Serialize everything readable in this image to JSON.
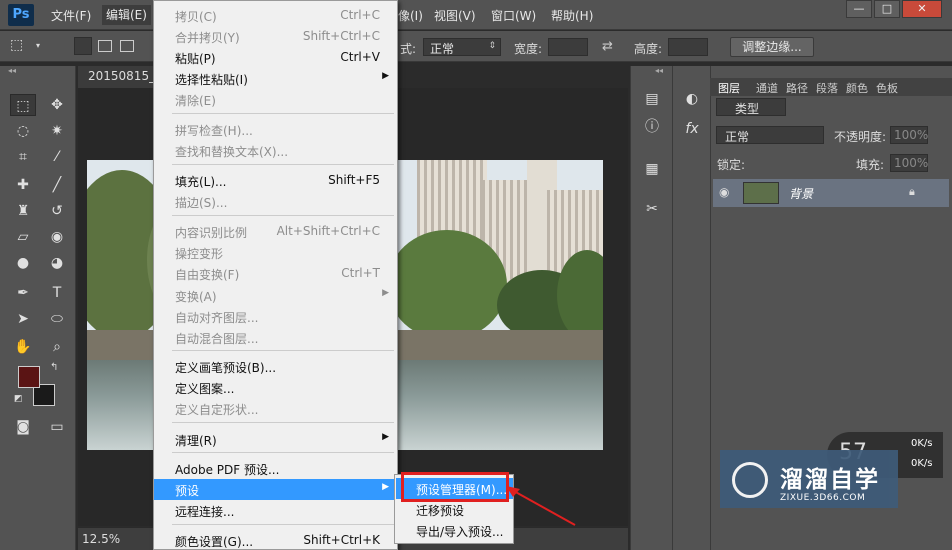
{
  "app": {
    "logo": "Ps"
  },
  "menubar": {
    "items": [
      "文件(F)",
      "编辑(E)",
      "窗口(W)",
      "帮助(H)"
    ],
    "hidden_left": "像(I)",
    "view": "视图(V)",
    "window_buttons": [
      "—",
      "□",
      "✕"
    ]
  },
  "options": {
    "style_label": "式:",
    "style_value": "正常",
    "width_label": "宽度:",
    "height_label": "高度:",
    "refine_button": "调整边缘..."
  },
  "document": {
    "tab_title": "20150815_1",
    "zoom": "12.5%"
  },
  "edit_menu": {
    "items": [
      {
        "label": "拷贝(C)",
        "shortcut": "Ctrl+C",
        "disabled": true
      },
      {
        "label": "合并拷贝(Y)",
        "shortcut": "Shift+Ctrl+C",
        "disabled": true
      },
      {
        "label": "粘贴(P)",
        "shortcut": "Ctrl+V",
        "disabled": false
      },
      {
        "label": "选择性粘贴(I)",
        "shortcut": "",
        "disabled": false,
        "submenu": true
      },
      {
        "label": "清除(E)",
        "shortcut": "",
        "disabled": true
      },
      {
        "label": "拼写检查(H)...",
        "shortcut": "",
        "disabled": true
      },
      {
        "label": "查找和替换文本(X)...",
        "shortcut": "",
        "disabled": true
      },
      {
        "label": "填充(L)...",
        "shortcut": "Shift+F5",
        "disabled": false
      },
      {
        "label": "描边(S)...",
        "shortcut": "",
        "disabled": true
      },
      {
        "label": "内容识别比例",
        "shortcut": "Alt+Shift+Ctrl+C",
        "disabled": true
      },
      {
        "label": "操控变形",
        "shortcut": "",
        "disabled": true
      },
      {
        "label": "自由变换(F)",
        "shortcut": "Ctrl+T",
        "disabled": true
      },
      {
        "label": "变换(A)",
        "shortcut": "",
        "disabled": true,
        "submenu": true
      },
      {
        "label": "自动对齐图层...",
        "shortcut": "",
        "disabled": true
      },
      {
        "label": "自动混合图层...",
        "shortcut": "",
        "disabled": true
      },
      {
        "label": "定义画笔预设(B)...",
        "shortcut": "",
        "disabled": false
      },
      {
        "label": "定义图案...",
        "shortcut": "",
        "disabled": false
      },
      {
        "label": "定义自定形状...",
        "shortcut": "",
        "disabled": true
      },
      {
        "label": "清理(R)",
        "shortcut": "",
        "disabled": false,
        "submenu": true
      },
      {
        "label": "Adobe PDF 预设...",
        "shortcut": "",
        "disabled": false
      },
      {
        "label": "预设",
        "shortcut": "",
        "disabled": false,
        "submenu": true,
        "highlighted": true
      },
      {
        "label": "远程连接...",
        "shortcut": "",
        "disabled": false
      },
      {
        "label": "颜色设置(G)...",
        "shortcut": "Shift+Ctrl+K",
        "disabled": false
      }
    ]
  },
  "presets_submenu": {
    "items": [
      "预设管理器(M)...",
      "迁移预设",
      "导出/导入预设..."
    ]
  },
  "layers_panel": {
    "tabs": [
      "图层",
      "通道",
      "路径",
      "段落",
      "颜色",
      "色板"
    ],
    "filter_label": "类型",
    "blend_mode": "正常",
    "opacity_label": "不透明度:",
    "opacity_value": "100%",
    "lock_label": "锁定:",
    "fill_label": "填充:",
    "fill_value": "100%",
    "layer_name": "背景"
  },
  "network": {
    "big": "57",
    "up": "0K/s",
    "down": "0K/s"
  },
  "watermark": {
    "title": "溜溜自学",
    "sub": "ZIXUE.3D66.COM"
  },
  "colors": {
    "foreground": "#5a1414",
    "background": "#1a1a1a",
    "highlight": "#3399ff",
    "callout": "#e02020"
  }
}
